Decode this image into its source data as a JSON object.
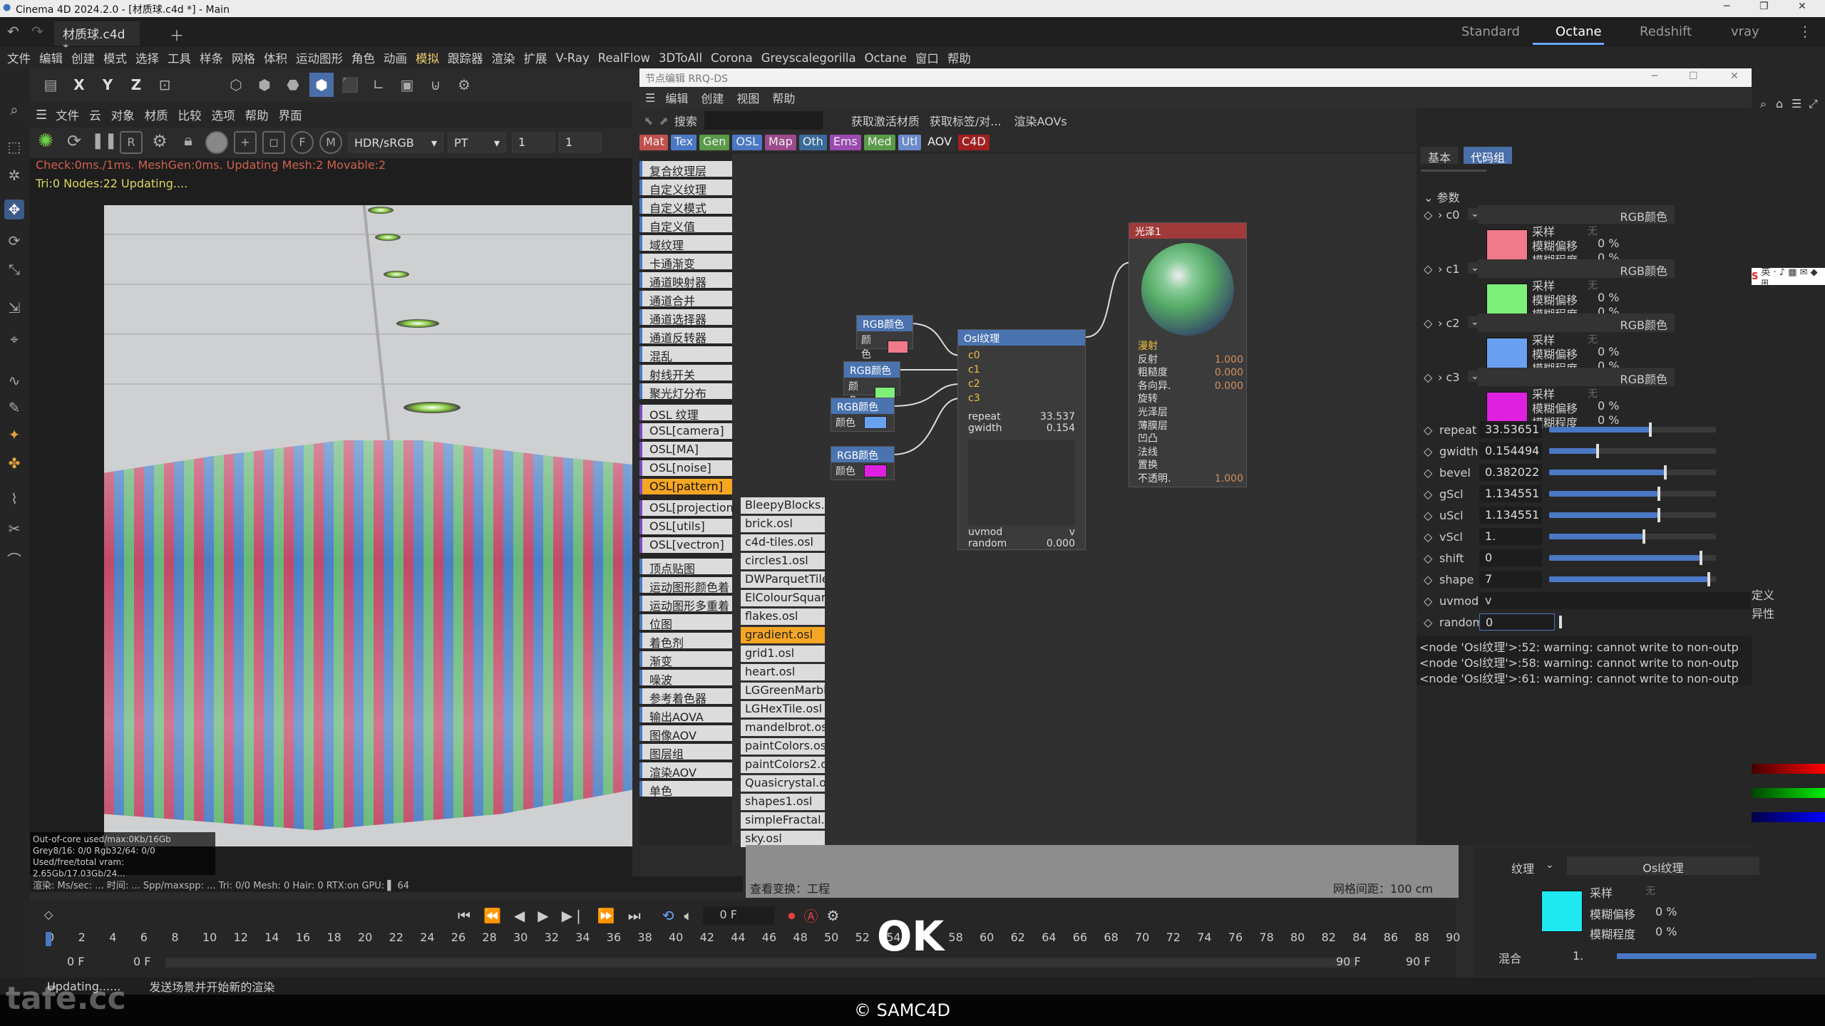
{
  "titlebar": {
    "title": "Cinema 4D 2024.2.0 - [材质球.c4d *] - Main"
  },
  "doc_tab": {
    "label": "材质球.c4d *"
  },
  "layout_tabs": [
    "Standard",
    "Octane",
    "Redshift",
    "vray"
  ],
  "menu": [
    "文件",
    "编辑",
    "创建",
    "模式",
    "选择",
    "工具",
    "样条",
    "网格",
    "体积",
    "运动图形",
    "角色",
    "动画",
    "模拟",
    "跟踪器",
    "渲染",
    "扩展",
    "V-Ray",
    "RealFlow",
    "3DToAll",
    "Corona",
    "Greyscalegorilla",
    "Octane",
    "窗口",
    "帮助"
  ],
  "toolbar2": {
    "x": "X",
    "y": "Y",
    "z": "Z"
  },
  "viewport_menu": [
    "文件",
    "云",
    "对象",
    "材质",
    "比较",
    "选项",
    "帮助",
    "界面"
  ],
  "vp_toolbar": {
    "colorspace": "HDR/sRGB",
    "mode": "PT",
    "v1": "1",
    "v2": "1"
  },
  "viewport_stats": {
    "line1": "Check:0ms./1ms. MeshGen:0ms. Updating Mesh:2 Movable:2",
    "line2": "Tri:0 Nodes:22  Updating...."
  },
  "vp_info": {
    "l1": "Out-of-core used/max:0Kb/16Gb",
    "l2": "Grey8/16: 0/0        Rgb32/64: 0/0",
    "l3": "Used/free/total vram: 2.65Gb/17.03Gb/24..."
  },
  "vp_status": "渲染:    Ms/sec: ...  时间: ...  Spp/maxspp: ...  Tri: 0/0  Mesh: 0   Hair: 0  RTX:on   GPU: ▌ 64",
  "nodewin": {
    "title": "节点编辑 RRQ-DS",
    "menu": [
      "编辑",
      "创建",
      "视图",
      "帮助"
    ],
    "search_label": "搜索",
    "btn_get_mat": "获取激活材质",
    "btn_get_tag": "获取标签/对...",
    "btn_render_aov": "渲染AOVs",
    "categories": [
      {
        "label": "Mat",
        "color": "#c0504d"
      },
      {
        "label": "Tex",
        "color": "#4a78c4"
      },
      {
        "label": "Gen",
        "color": "#5a9a48"
      },
      {
        "label": "OSL",
        "color": "#4a78c4"
      },
      {
        "label": "Map",
        "color": "#9b4a8a"
      },
      {
        "label": "Oth",
        "color": "#3a6a9a"
      },
      {
        "label": "Ems",
        "color": "#9a4ab0"
      },
      {
        "label": "Med",
        "color": "#5a9a48"
      },
      {
        "label": "Utl",
        "color": "#6a8acb"
      },
      {
        "label": "AOV",
        "color": "#2e2e2e"
      },
      {
        "label": "C4D",
        "color": "#a02020"
      }
    ],
    "node_list": [
      "复合纹理层",
      "自定义纹理",
      "自定义模式",
      "自定义值",
      "域纹理",
      "卡通渐变",
      "通道映射器",
      "通道合并",
      "通道选择器",
      "通道反转器",
      "混乱",
      "射线开关",
      "聚光灯分布",
      "OSL 纹理",
      "OSL[camera]",
      "OSL[MA]",
      "OSL[noise]",
      "OSL[pattern]",
      "OSL[projection]",
      "OSL[utils]",
      "OSL[vectron]",
      "顶点贴图",
      "运动图形颜色着",
      "运动图形多重着",
      "位图",
      "着色剂",
      "渐变",
      "噪波",
      "参考着色器",
      "输出AOVA",
      "图像AOV",
      "图层组",
      "渲染AOV",
      "单色"
    ],
    "sub_list": [
      "BleepyBlocks.osl",
      "brick.osl",
      "c4d-tiles.osl",
      "circles1.osl",
      "DWParquetTile",
      "ElColourSquar",
      "flakes.osl",
      "gradient.osl",
      "grid1.osl",
      "heart.osl",
      "LGGreenMarbl",
      "LGHexTile.osl",
      "mandelbrot.os",
      "paintColors.os",
      "paintColors2.o",
      "Quasicrystal.o",
      "shapes1.osl",
      "simpleFractal.",
      "sky.osl"
    ],
    "rgb_nodes": [
      {
        "title": "RGB颜色",
        "label": "颜色",
        "color": "#f07a8a"
      },
      {
        "title": "RGB颜色",
        "label": "颜色",
        "color": "#7ef07a"
      },
      {
        "title": "RGB颜色",
        "label": "颜色",
        "color": "#6aa0f0"
      },
      {
        "title": "RGB颜色",
        "label": "颜色",
        "color": "#e020e0"
      }
    ],
    "osl_node": {
      "title": "Osl纹理",
      "inputs": [
        "c0",
        "c1",
        "c2",
        "c3"
      ],
      "repeat_label": "repeat",
      "repeat": "33.537",
      "gwidth_label": "gwidth",
      "gwidth": "0.154",
      "uvmod_label": "uvmod",
      "uvmod": "v",
      "random_label": "random",
      "random": "0.000"
    },
    "gloss_node": {
      "title": "光泽1",
      "ports": [
        {
          "label": "漫射",
          "value": ""
        },
        {
          "label": "反射",
          "value": "1.000"
        },
        {
          "label": "粗糙度",
          "value": "0.000"
        },
        {
          "label": "各向异.",
          "value": "0.000"
        },
        {
          "label": "旋转",
          "value": ""
        },
        {
          "label": "光泽层",
          "value": ""
        },
        {
          "label": "薄膜层",
          "value": ""
        },
        {
          "label": "凹凸",
          "value": ""
        },
        {
          "label": "法线",
          "value": ""
        },
        {
          "label": "置换",
          "value": ""
        },
        {
          "label": "不透明.",
          "value": "1.000"
        }
      ]
    }
  },
  "attr": {
    "tabs": [
      "基本",
      "代码组"
    ],
    "section": "参数",
    "color_params": [
      {
        "name": "c0",
        "type": "RGB颜色",
        "color": "#f07a8a",
        "sample": "采样",
        "sample_val": "无",
        "blur_offset": "模糊偏移",
        "blur_offset_val": "0 %",
        "blur_deg": "模糊程度",
        "blur_deg_val": "0 %"
      },
      {
        "name": "c1",
        "type": "RGB颜色",
        "color": "#7ef07a",
        "sample": "采样",
        "sample_val": "无",
        "blur_offset": "模糊偏移",
        "blur_offset_val": "0 %",
        "blur_deg": "模糊程度",
        "blur_deg_val": "0 %"
      },
      {
        "name": "c2",
        "type": "RGB颜色",
        "color": "#6aa0f0",
        "sample": "采样",
        "sample_val": "无",
        "blur_offset": "模糊偏移",
        "blur_offset_val": "0 %",
        "blur_deg": "模糊程度",
        "blur_deg_val": "0 %"
      },
      {
        "name": "c3",
        "type": "RGB颜色",
        "color": "#e020e0",
        "sample": "采样",
        "sample_val": "无",
        "blur_offset": "模糊偏移",
        "blur_offset_val": "0 %",
        "blur_deg": "模糊程度",
        "blur_deg_val": "0 %"
      }
    ],
    "num_params": [
      {
        "name": "repeat",
        "value": "33.53651",
        "level": 0.6
      },
      {
        "name": "gwidth",
        "value": "0.154494",
        "level": 0.28
      },
      {
        "name": "bevel",
        "value": "0.382022",
        "level": 0.69
      },
      {
        "name": "gScl",
        "value": "1.134551",
        "level": 0.65
      },
      {
        "name": "uScl",
        "value": "1.134551",
        "level": 0.65
      },
      {
        "name": "vScl",
        "value": "1.",
        "level": 0.56
      },
      {
        "name": "shift",
        "value": "0",
        "level": 0.9
      },
      {
        "name": "shape",
        "value": "7",
        "level": 0.95
      }
    ],
    "uvmod": {
      "name": "uvmod",
      "value": "v"
    },
    "random": {
      "name": "random",
      "value": "0"
    },
    "log": [
      "<node 'Osl纹理'>:52: warning: cannot write to non-outp",
      "<node 'Osl纹理'>:58: warning: cannot write to non-outp",
      "<node 'Osl纹理'>:61: warning: cannot write to non-outp"
    ]
  },
  "bottomright": {
    "texture_label": "纹理",
    "texture_value": "Osl纹理",
    "sample": "采样",
    "sample_val": "无",
    "blur_offset": "模糊偏移",
    "blur_offset_val": "0 %",
    "blur_deg": "模糊程度",
    "blur_deg_val": "0 %",
    "mix_label": "混合",
    "mix_value": "1.",
    "color": "#20e8f0",
    "right_labels": [
      "定义",
      "异性"
    ]
  },
  "viewer_strip": {
    "view_label": "查看变换：工程",
    "grid_label": "网格间距：100 cm"
  },
  "timeline": {
    "frame": "0 F",
    "ticks": [
      "0",
      "2",
      "4",
      "6",
      "8",
      "10",
      "12",
      "14",
      "16",
      "18",
      "20",
      "22",
      "24",
      "26",
      "28",
      "30",
      "32",
      "34",
      "36",
      "38",
      "40",
      "42",
      "44",
      "46",
      "48",
      "50",
      "52",
      "54",
      "56",
      "58",
      "60",
      "62",
      "64",
      "66",
      "68",
      "70",
      "72",
      "74",
      "76",
      "78",
      "80",
      "82",
      "84",
      "86",
      "88",
      "90"
    ],
    "start1": "0 F",
    "start2": "0 F",
    "end1": "90 F",
    "end2": "90 F"
  },
  "statusbar": {
    "left": "Updating......",
    "msg": "发送场景并开始新的渲染"
  },
  "overlay": {
    "ok": "OK",
    "copyright": "© SAMC4D",
    "logo": "tafe.cc"
  }
}
